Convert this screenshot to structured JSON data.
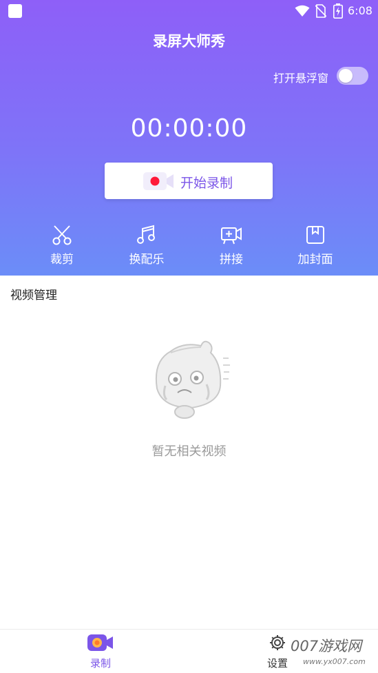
{
  "status_bar": {
    "time": "6:08",
    "icons": [
      "app-notification-icon",
      "wifi-icon",
      "no-sim-icon",
      "battery-charging-icon"
    ]
  },
  "header": {
    "title": "录屏大师秀",
    "floating_window": {
      "label": "打开悬浮窗",
      "enabled": false
    }
  },
  "recorder": {
    "timer": "00:00:00",
    "start_button": {
      "label": "开始录制",
      "icon": "record-camera-icon"
    }
  },
  "tools": [
    {
      "label": "裁剪",
      "icon": "scissors-icon"
    },
    {
      "label": "换配乐",
      "icon": "music-note-icon"
    },
    {
      "label": "拼接",
      "icon": "video-add-icon"
    },
    {
      "label": "加封面",
      "icon": "cover-icon"
    }
  ],
  "video_management": {
    "title": "视频管理",
    "empty_text": "暂无相关视频",
    "empty_icon": "crying-mascot-icon"
  },
  "bottom_nav": [
    {
      "label": "录制",
      "icon": "record-camera-icon",
      "active": true
    },
    {
      "label": "设置",
      "icon": "gear-icon",
      "active": false
    }
  ],
  "watermark": {
    "text": "007游戏网",
    "sub": "www.yx007.com"
  },
  "colors": {
    "header_top": "#8e5ff8",
    "header_bottom": "#6b8df8",
    "accent": "#7b55e8",
    "record_dot": "#ff1a3a",
    "empty_text": "#9a9a9a"
  }
}
